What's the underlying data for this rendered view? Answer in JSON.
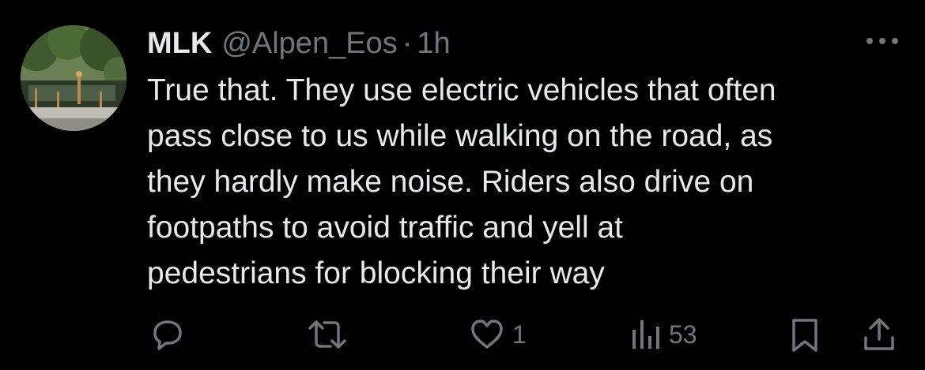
{
  "tweet": {
    "author": {
      "display_name": "MLK",
      "handle": "@Alpen_Eos",
      "separator": "·",
      "time": "1h"
    },
    "text": "True that. They use electric vehicles that often\npass close to us while walking on the road, as\nthey hardly make noise. Riders also drive on\nfootpaths to avoid traffic and yell at\npedestrians for blocking their way",
    "actions": {
      "reply_icon": "reply-bubble-icon",
      "retweet_icon": "retweet-icon",
      "like_icon": "heart-icon",
      "like_count": "1",
      "views_icon": "views-bar-chart-icon",
      "views_count": "53",
      "bookmark_icon": "bookmark-icon",
      "share_icon": "share-upload-icon"
    },
    "more_icon": "more-dots-icon"
  },
  "colors": {
    "background": "#000000",
    "primary_text": "#e7e9ea",
    "secondary_text": "#71767b"
  }
}
